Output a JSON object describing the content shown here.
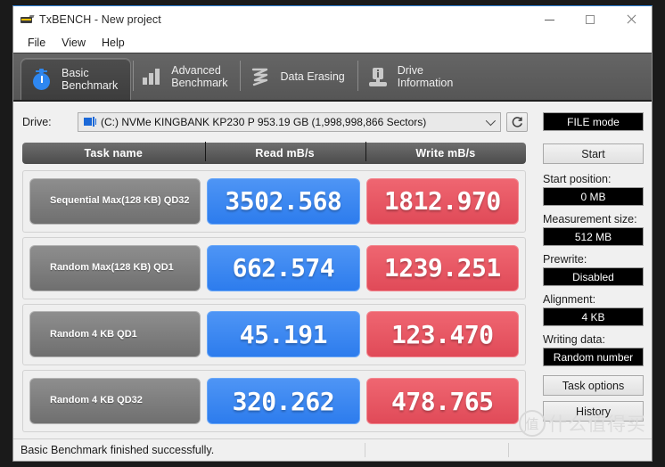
{
  "window": {
    "title": "TxBENCH - New project",
    "icon": "drive-app-icon",
    "controls": {
      "minimize": "minimize-icon",
      "maximize": "maximize-icon",
      "close": "close-icon"
    }
  },
  "menu": {
    "items": [
      "File",
      "View",
      "Help"
    ]
  },
  "tabs": [
    {
      "label": "Basic\nBenchmark",
      "icon": "stopwatch-icon",
      "active": true
    },
    {
      "label": "Advanced\nBenchmark",
      "icon": "bar-chart-icon",
      "active": false
    },
    {
      "label": "Data Erasing",
      "icon": "shred-icon",
      "active": false
    },
    {
      "label": "Drive\nInformation",
      "icon": "drive-info-icon",
      "active": false
    }
  ],
  "drive": {
    "label": "Drive:",
    "selected": "(C:) NVMe KINGBANK KP230 P  953.19 GB (1,998,998,866 Sectors)",
    "icon": "drive-small-icon",
    "caret": "chevron-down-icon",
    "refresh": "refresh-icon"
  },
  "table": {
    "headers": [
      "Task name",
      "Read mB/s",
      "Write mB/s"
    ],
    "rows": [
      {
        "task": "Sequential\nMax(128 KB) QD32",
        "read": "3502.568",
        "write": "1812.970"
      },
      {
        "task": "Random\nMax(128 KB) QD1",
        "read": "662.574",
        "write": "1239.251"
      },
      {
        "task": "Random\n4 KB QD1",
        "read": "45.191",
        "write": "123.470"
      },
      {
        "task": "Random\n4 KB QD32",
        "read": "320.262",
        "write": "478.765"
      }
    ]
  },
  "panel": {
    "mode": "FILE mode",
    "start_button": "Start",
    "start_position_label": "Start position:",
    "start_position_value": "0 MB",
    "measurement_size_label": "Measurement size:",
    "measurement_size_value": "512 MB",
    "prewrite_label": "Prewrite:",
    "prewrite_value": "Disabled",
    "alignment_label": "Alignment:",
    "alignment_value": "4 KB",
    "writing_data_label": "Writing data:",
    "writing_data_value": "Random number",
    "task_options_button": "Task options",
    "history_button": "History"
  },
  "status": {
    "text": "Basic Benchmark finished successfully."
  },
  "watermark": {
    "logo": "值",
    "text": "什么值得买"
  },
  "colors": {
    "read": "#2d7ced",
    "write": "#e04a58",
    "tab_bar": "#5b5b5b",
    "accent": "#2b7fd4",
    "display_bg": "#000000"
  }
}
